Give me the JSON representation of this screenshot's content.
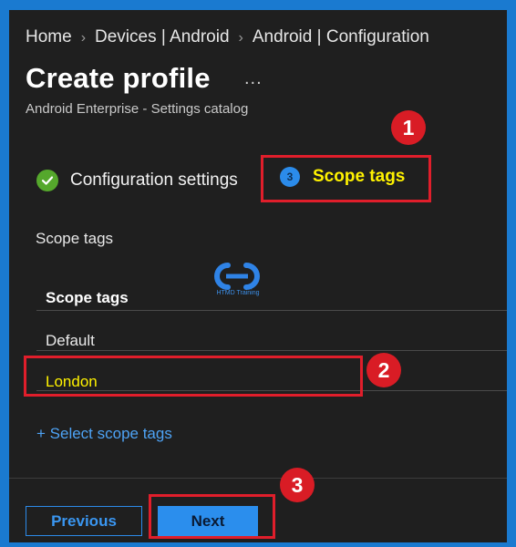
{
  "breadcrumb": {
    "items": [
      "Home",
      "Devices | Android",
      "Android | Configuration"
    ],
    "separator": "›"
  },
  "header": {
    "title": "Create profile",
    "more": "...",
    "subtitle": "Android Enterprise - Settings catalog"
  },
  "steps": {
    "step1": {
      "label": "Configuration settings",
      "status": "completed"
    },
    "step2": {
      "number": "3",
      "label": "Scope tags",
      "status": "current"
    }
  },
  "section": {
    "label": "Scope tags"
  },
  "watermark": {
    "logo_text": "HTMD Training"
  },
  "table": {
    "column_header": "Scope tags",
    "rows": [
      "Default",
      "London"
    ]
  },
  "add_link": "+ Select scope tags",
  "annotations": {
    "badge1": "1",
    "badge2": "2",
    "badge3": "3"
  },
  "footer": {
    "previous": "Previous",
    "next": "Next"
  },
  "colors": {
    "highlight_red": "#e01e2b",
    "highlight_yellow": "#fff200",
    "accent_blue": "#2b8eed",
    "check_green": "#55a82c"
  }
}
